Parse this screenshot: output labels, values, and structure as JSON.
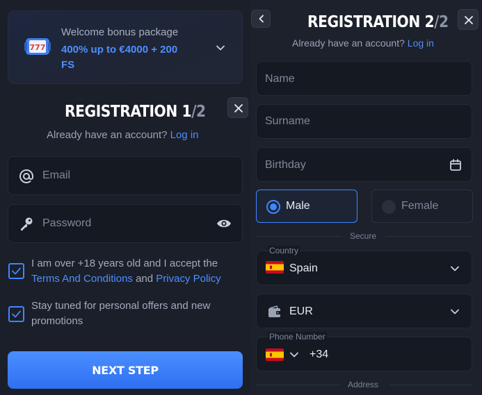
{
  "bonus": {
    "title": "Welcome bonus package",
    "amount": "400% up to €4000 + 200 FS"
  },
  "step1": {
    "title_word": "REGISTRATION",
    "step": "1",
    "separator": "/",
    "total": "2",
    "have_account": "Already have an account?",
    "login_link": "Log in",
    "email_placeholder": "Email",
    "password_placeholder": "Password",
    "age_text_1": "I am over +18 years old and I accept the",
    "terms_link": "Terms And Conditions",
    "and_text": "and",
    "privacy_link": "Privacy Policy",
    "offers_text": "Stay tuned for personal offers and new promotions",
    "next_button": "NEXT STEP"
  },
  "step2": {
    "title_word": "REGISTRATION",
    "step": "2",
    "separator": "/",
    "total": "2",
    "have_account": "Already have an account?",
    "login_link": "Log in",
    "name_placeholder": "Name",
    "surname_placeholder": "Surname",
    "birthday_placeholder": "Birthday",
    "gender_male": "Male",
    "gender_female": "Female",
    "selected_gender": "male",
    "secure_divider": "Secure",
    "country_label": "Country",
    "country_value": "Spain",
    "currency_value": "EUR",
    "phone_label": "Phone Number",
    "phone_code": "+34",
    "address_divider": "Address"
  },
  "colors": {
    "accent": "#4d8fff",
    "button": "#3a7cf8",
    "background": "#1b1f2a",
    "field": "#151922"
  },
  "icons": [
    "slot-777-icon",
    "chevron-down-icon",
    "close-icon",
    "at-icon",
    "key-icon",
    "eye-icon",
    "check-icon",
    "chevron-left-icon",
    "calendar-icon",
    "wallet-icon",
    "spain-flag-icon"
  ]
}
